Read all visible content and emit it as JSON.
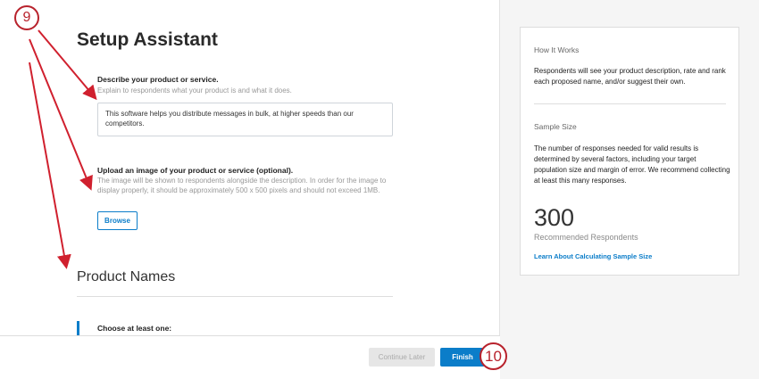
{
  "main": {
    "title": "Setup Assistant",
    "describe_label": "Describe your product or service.",
    "describe_hint": "Explain to respondents what your product is and what it does.",
    "describe_value": "This software helps you distribute messages in bulk, at higher speeds than our competitors.",
    "upload_label": "Upload an image of your product or service (optional).",
    "upload_hint": "The image will be shown to respondents alongside the description. In order for the image to display properly, it should be approximately 500 x 500 pixels and should not exceed 1MB.",
    "browse_label": "Browse",
    "product_names_heading": "Product Names",
    "choose_label": "Choose at least one:"
  },
  "footer": {
    "continue_later": "Continue Later",
    "finish": "Finish"
  },
  "side": {
    "how_heading": "How It Works",
    "how_text": "Respondents will see your product description, rate and rank each proposed name, and/or suggest their own.",
    "sample_heading": "Sample Size",
    "sample_text": "The number of responses needed for valid results is determined by several factors, including your target population size and margin of error. We recommend collecting at least this many responses.",
    "count": "300",
    "count_label": "Recommended Respondents",
    "link": "Learn About Calculating Sample Size"
  },
  "callouts": {
    "a": "9",
    "b": "10",
    "color": "#b8222c"
  }
}
